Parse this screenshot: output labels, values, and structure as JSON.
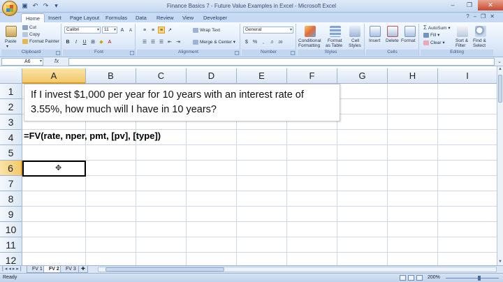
{
  "window": {
    "title": "Finance Basics 7 - Future Value Examples in Excel - Microsoft Excel"
  },
  "ribbon_tabs": [
    "Home",
    "Insert",
    "Page Layout",
    "Formulas",
    "Data",
    "Review",
    "View",
    "Developer"
  ],
  "active_tab": "Home",
  "ribbon": {
    "clipboard": {
      "paste": "Paste",
      "cut": "Cut",
      "copy": "Copy",
      "format_painter": "Format Painter",
      "label": "Clipboard"
    },
    "font": {
      "name": "Calibri",
      "size": "11",
      "label": "Font"
    },
    "alignment": {
      "wrap_text": "Wrap Text",
      "merge_center": "Merge & Center",
      "label": "Alignment"
    },
    "number": {
      "format": "General",
      "label": "Number"
    },
    "styles": {
      "conditional": "Conditional",
      "conditional2": "Formatting",
      "format_table": "Format",
      "format_table2": "as Table",
      "cell_styles": "Cell",
      "cell_styles2": "Styles",
      "label": "Styles"
    },
    "cells": {
      "insert": "Insert",
      "delete": "Delete",
      "format": "Format",
      "label": "Cells"
    },
    "editing": {
      "autosum": "AutoSum",
      "fill": "Fill",
      "clear": "Clear",
      "sort_filter": "Sort &",
      "sort_filter2": "Filter",
      "find_select": "Find &",
      "find_select2": "Select",
      "label": "Editing"
    }
  },
  "formula_bar": {
    "name_box": "A6",
    "fx": "fx",
    "formula": ""
  },
  "grid": {
    "columns": [
      "A",
      "B",
      "C",
      "D",
      "E",
      "F",
      "G",
      "H",
      "I"
    ],
    "rows": [
      "1",
      "2",
      "3",
      "4",
      "5",
      "6",
      "7",
      "8",
      "9",
      "10",
      "11",
      "12"
    ],
    "selected_column": "A",
    "selected_row": "6",
    "textbox_line1": "If I invest $1,000 per year for 10 years with an interest rate of",
    "textbox_line2": "3.55%, how much will I have in 10 years?",
    "cell_a4": "=FV(rate, nper, pmt, [pv], [type])"
  },
  "sheets": [
    "FV 1",
    "FV 2",
    "FV 3"
  ],
  "active_sheet": "FV 2",
  "status": {
    "ready": "Ready",
    "zoom": "200%"
  }
}
